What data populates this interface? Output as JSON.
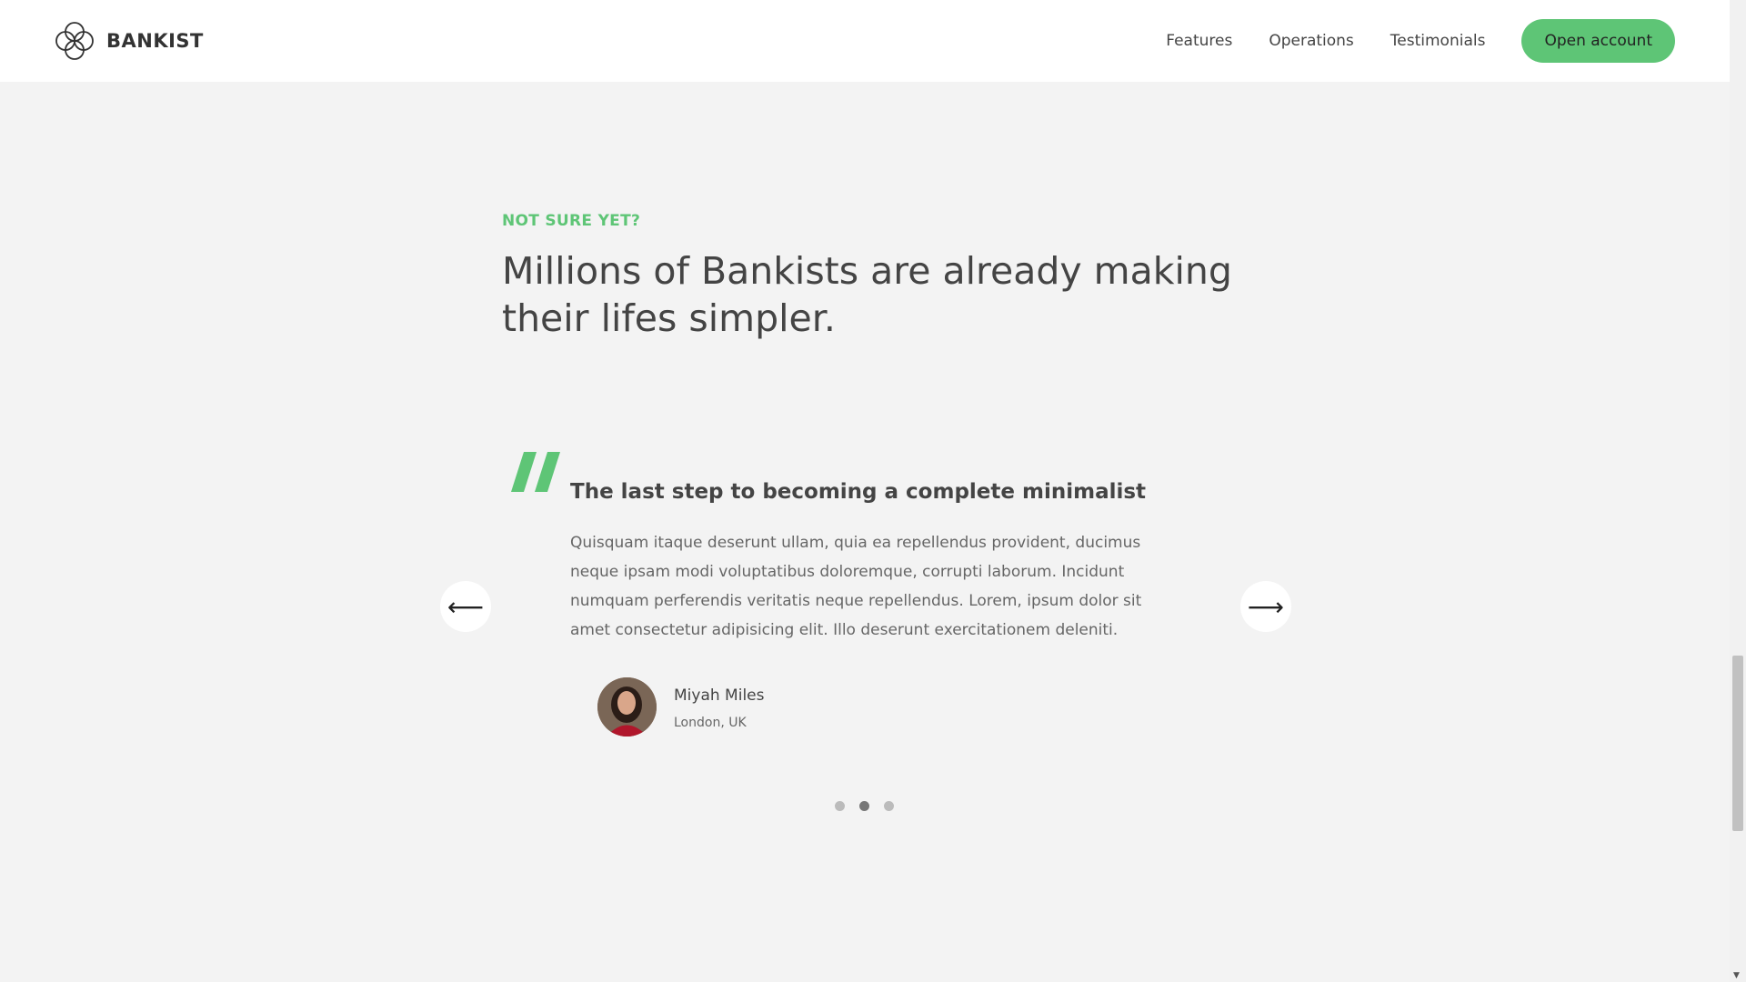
{
  "header": {
    "logo_text": "BANKIST",
    "nav": [
      "Features",
      "Operations",
      "Testimonials"
    ],
    "cta_label": "Open account"
  },
  "section": {
    "eyebrow": "NOT SURE YET?",
    "heading": "Millions of Bankists are already making their lifes simpler."
  },
  "testimonial": {
    "title": "The last step to becoming a complete minimalist",
    "body": "Quisquam itaque deserunt ullam, quia ea repellendus provident, ducimus neque ipsam modi voluptatibus doloremque, corrupti laborum. Incidunt numquam perferendis veritatis neque repellendus. Lorem, ipsum dolor sit amet consectetur adipisicing elit. Illo deserunt exercitationem deleniti.",
    "author_name": "Miyah Miles",
    "author_location": "London, UK"
  },
  "slider": {
    "prev_icon": "arrow-left-icon",
    "next_icon": "arrow-right-icon",
    "prev_glyph": "⟵",
    "next_glyph": "⟶",
    "dot_count": 3,
    "active_dot": 2
  },
  "colors": {
    "accent": "#5ec576",
    "background": "#f3f3f3",
    "header_bg": "#ffffff"
  }
}
